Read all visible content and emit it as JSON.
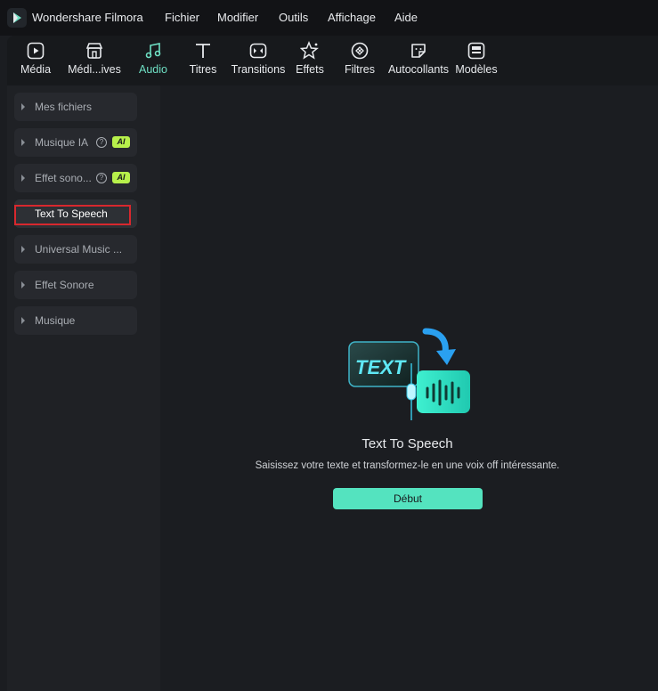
{
  "app": {
    "title": "Wondershare Filmora"
  },
  "menu": [
    "Fichier",
    "Modifier",
    "Outils",
    "Affichage",
    "Aide"
  ],
  "toolbar": {
    "tabs": [
      {
        "label": "Média",
        "icon": "media-icon"
      },
      {
        "label": "Médi...ives",
        "icon": "store-icon"
      },
      {
        "label": "Audio",
        "icon": "music-note-icon",
        "active": true
      },
      {
        "label": "Titres",
        "icon": "text-t-icon"
      },
      {
        "label": "Transitions",
        "icon": "transition-icon"
      },
      {
        "label": "Effets",
        "icon": "effects-star-icon"
      },
      {
        "label": "Filtres",
        "icon": "filter-icon"
      },
      {
        "label": "Autocollants",
        "icon": "sticker-icon"
      },
      {
        "label": "Modèles",
        "icon": "template-icon"
      }
    ]
  },
  "sidebar": {
    "items": [
      {
        "label": "Mes fichiers"
      },
      {
        "label": "Musique IA",
        "badge": "AI"
      },
      {
        "label": "Effet sono...",
        "badge": "AI"
      },
      {
        "label": "Text To Speech",
        "selected": true
      },
      {
        "label": "Universal Music ..."
      },
      {
        "label": "Effet Sonore"
      },
      {
        "label": "Musique"
      }
    ]
  },
  "main": {
    "illustration_text": "TEXT",
    "title": "Text To Speech",
    "description": "Saisissez votre texte et transformez-le en une voix off intéressante.",
    "start_button": "Début"
  },
  "colors": {
    "accent": "#54e3bf",
    "active_tab": "#6fe0c4",
    "ai_badge": "#b7f04b",
    "highlight": "#d8282e"
  }
}
